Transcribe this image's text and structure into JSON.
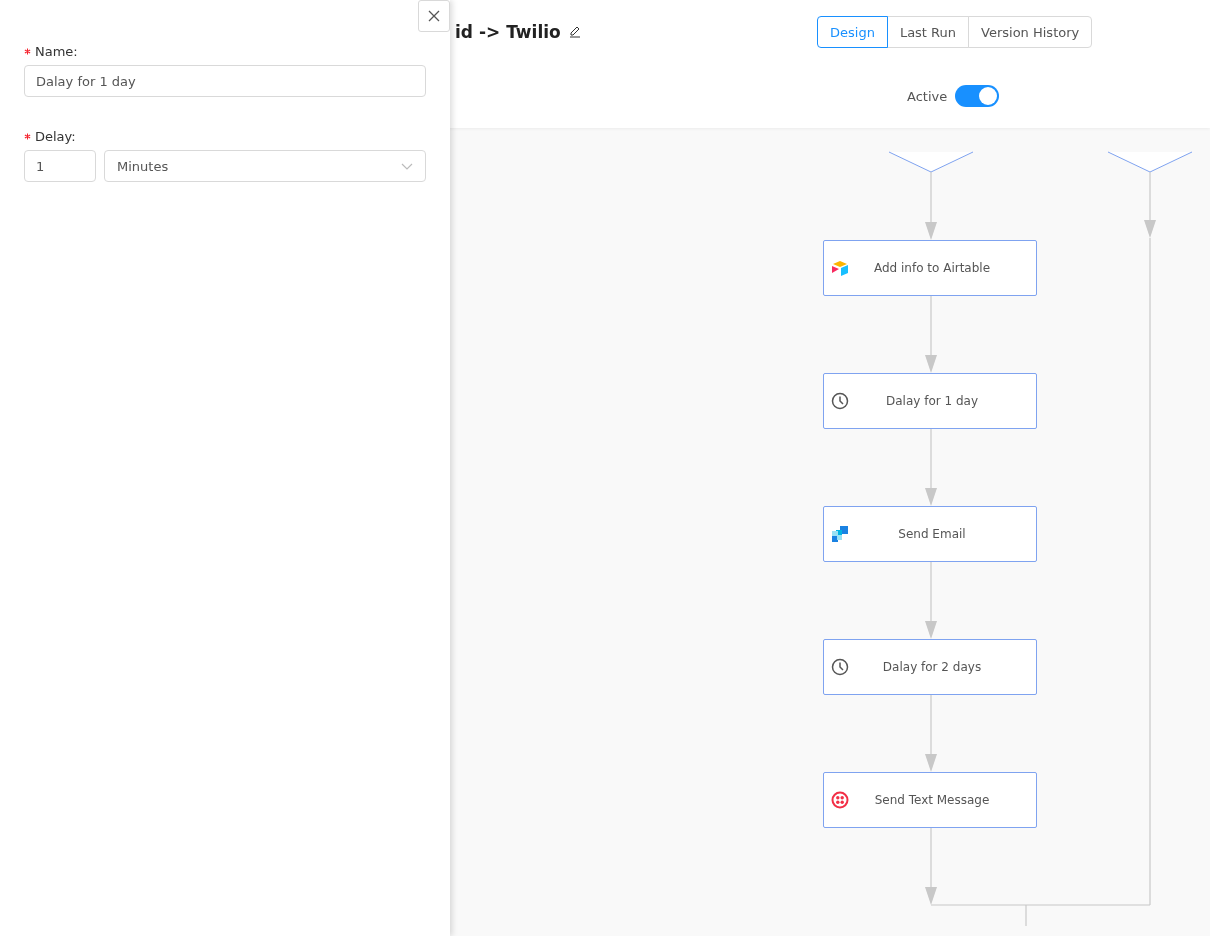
{
  "header": {
    "title": "id -> Twilio",
    "tabs": [
      {
        "label": "Design",
        "selected": true
      },
      {
        "label": "Last Run",
        "selected": false
      },
      {
        "label": "Version History",
        "selected": false
      }
    ],
    "active_toggle": {
      "label": "Active",
      "on": true
    }
  },
  "flow": {
    "nodes": [
      {
        "label": "Add info to Airtable",
        "kind": "airtable"
      },
      {
        "label": "Dalay for 1 day",
        "kind": "delay"
      },
      {
        "label": "Send Email",
        "kind": "email"
      },
      {
        "label": "Dalay for 2 days",
        "kind": "delay"
      },
      {
        "label": "Send Text Message",
        "kind": "sms"
      }
    ]
  },
  "drawer": {
    "fields": [
      {
        "label": "Name:",
        "required": true,
        "kind": "text",
        "value": "Dalay for 1 day"
      },
      {
        "label": "Delay:",
        "required": true,
        "kind": "delay",
        "value": "1",
        "unit": "Minutes"
      }
    ]
  }
}
